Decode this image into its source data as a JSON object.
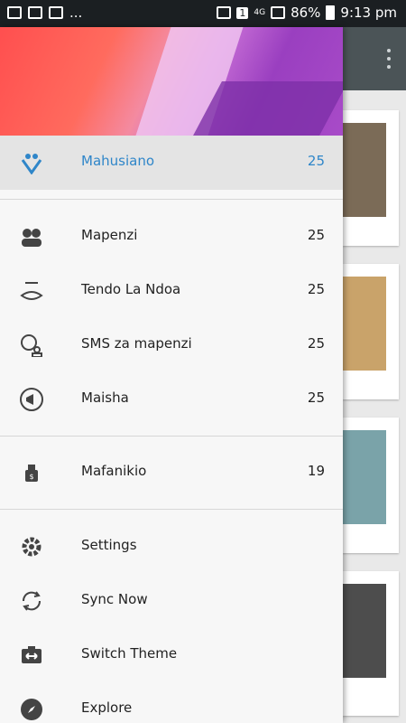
{
  "status_bar": {
    "left_icons": [
      "notification-icon",
      "message-icon",
      "mail-icon"
    ],
    "more": "...",
    "sim": "1",
    "network": "4G",
    "battery": "86%",
    "time": "9:13 pm"
  },
  "drawer": {
    "active": {
      "label": "Mahusiano",
      "count": "25",
      "icon": "heart-people-icon"
    },
    "categories": [
      {
        "label": "Mapenzi",
        "count": "25",
        "icon": "couple-icon"
      },
      {
        "label": "Tendo La Ndoa",
        "count": "25",
        "icon": "sex-lips-icon"
      },
      {
        "label": "SMS za mapenzi",
        "count": "25",
        "icon": "love-message-icon"
      },
      {
        "label": "Maisha",
        "count": "25",
        "icon": "megaphone-icon"
      }
    ],
    "other": {
      "label": "Mafanikio",
      "count": "19",
      "icon": "money-bag-icon"
    },
    "menu": [
      {
        "label": "Settings",
        "icon": "gear-icon"
      },
      {
        "label": "Sync Now",
        "icon": "sync-icon"
      },
      {
        "label": "Switch Theme",
        "icon": "switch-theme-icon"
      },
      {
        "label": "Explore",
        "icon": "compass-icon"
      }
    ]
  },
  "colors": {
    "accent": "#2f86c9",
    "toolbar": "#4b5457",
    "drawer_bg": "#f7f7f7"
  }
}
